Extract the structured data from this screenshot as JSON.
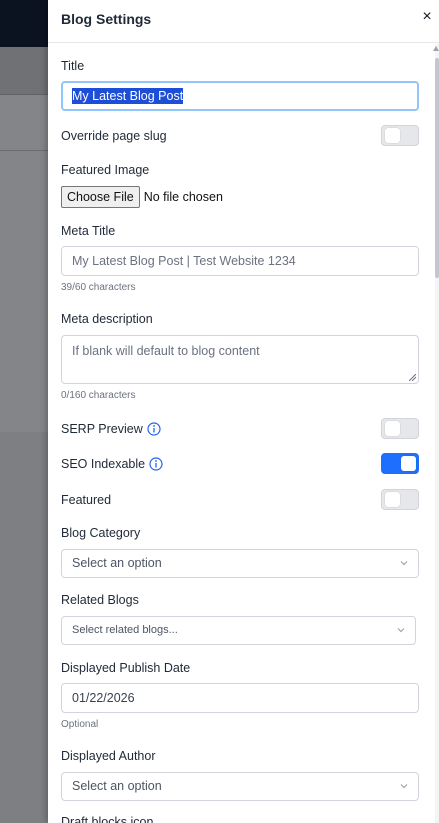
{
  "drawer": {
    "title": "Blog Settings",
    "close_glyph": "×"
  },
  "fields": {
    "title_label": "Title",
    "title_value": "My Latest Blog Post",
    "override_slug_label": "Override page slug",
    "override_slug_on": false,
    "featured_image_label": "Featured Image",
    "choose_file_label": "Choose File",
    "no_file_text": "No file chosen",
    "meta_title_label": "Meta Title",
    "meta_title_placeholder": "My Latest Blog Post | Test Website 1234",
    "meta_title_count": "39/60 characters",
    "meta_description_label": "Meta description",
    "meta_description_placeholder": "If blank will default to blog content",
    "meta_description_count": "0/160 characters",
    "serp_preview_label": "SERP Preview",
    "serp_preview_on": false,
    "seo_indexable_label": "SEO Indexable",
    "seo_indexable_on": true,
    "featured_label": "Featured",
    "featured_on": false,
    "blog_category_label": "Blog Category",
    "blog_category_placeholder": "Select an option",
    "related_blogs_label": "Related Blogs",
    "related_blogs_placeholder": "Select related blogs...",
    "publish_date_label": "Displayed Publish Date",
    "publish_date_value": "01/22/2026",
    "publish_date_hint": "Optional",
    "author_label": "Displayed Author",
    "author_placeholder": "Select an option",
    "next_label": "Draft blocks icon"
  },
  "colors": {
    "accent": "#1e6fff",
    "info_icon": "#2563eb",
    "overlay": "#7d7f82"
  },
  "icons": [
    "close-icon",
    "info-icon",
    "chevron-down-icon"
  ]
}
